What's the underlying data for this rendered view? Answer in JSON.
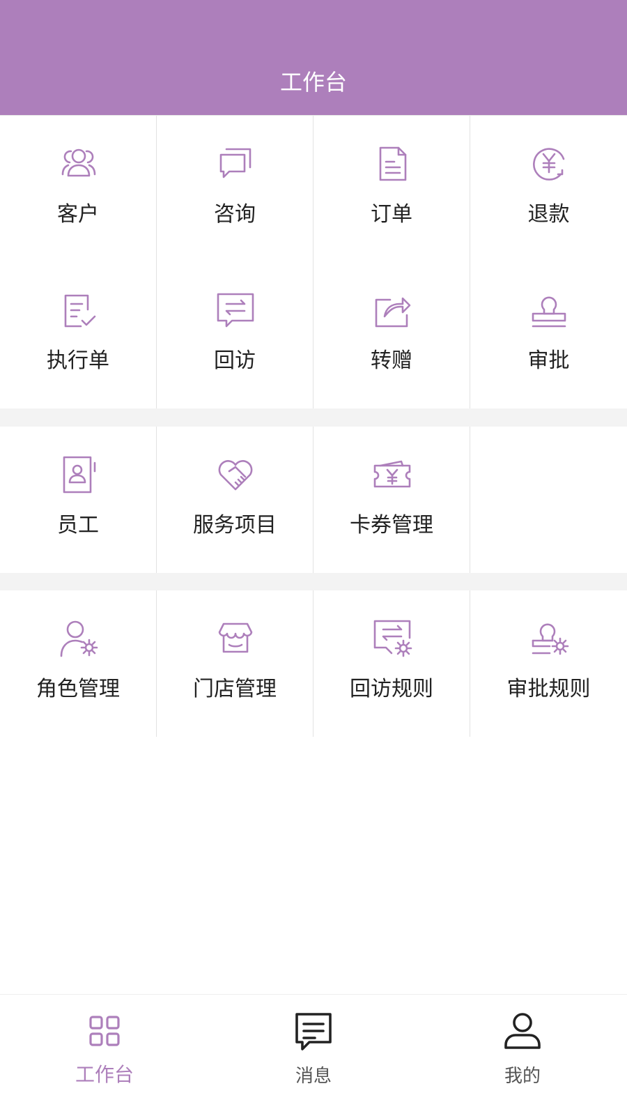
{
  "header": {
    "title": "工作台"
  },
  "sections": [
    {
      "rows": [
        [
          {
            "label": "客户",
            "icon": "customers-icon"
          },
          {
            "label": "咨询",
            "icon": "consult-icon"
          },
          {
            "label": "订单",
            "icon": "order-icon"
          },
          {
            "label": "退款",
            "icon": "refund-icon"
          }
        ],
        [
          {
            "label": "执行单",
            "icon": "execution-order-icon"
          },
          {
            "label": "回访",
            "icon": "follow-up-icon"
          },
          {
            "label": "转赠",
            "icon": "transfer-gift-icon"
          },
          {
            "label": "审批",
            "icon": "approval-stamp-icon"
          }
        ]
      ]
    },
    {
      "rows": [
        [
          {
            "label": "员工",
            "icon": "employee-icon"
          },
          {
            "label": "服务项目",
            "icon": "service-item-icon"
          },
          {
            "label": "卡券管理",
            "icon": "coupon-management-icon"
          },
          {
            "label": "",
            "icon": ""
          }
        ]
      ]
    },
    {
      "rows": [
        [
          {
            "label": "角色管理",
            "icon": "role-management-icon"
          },
          {
            "label": "门店管理",
            "icon": "store-management-icon"
          },
          {
            "label": "回访规则",
            "icon": "follow-up-rules-icon"
          },
          {
            "label": "审批规则",
            "icon": "approval-rules-icon"
          }
        ]
      ]
    }
  ],
  "tabbar": {
    "items": [
      {
        "label": "工作台",
        "icon": "workbench-grid-icon",
        "active": true
      },
      {
        "label": "消息",
        "icon": "message-icon",
        "active": false
      },
      {
        "label": "我的",
        "icon": "profile-icon",
        "active": false
      }
    ]
  },
  "colors": {
    "accent": "#ad7fbb",
    "divider": "#e2e2e2",
    "sectionGap": "#f3f3f3",
    "tabInactive": "#333333"
  }
}
